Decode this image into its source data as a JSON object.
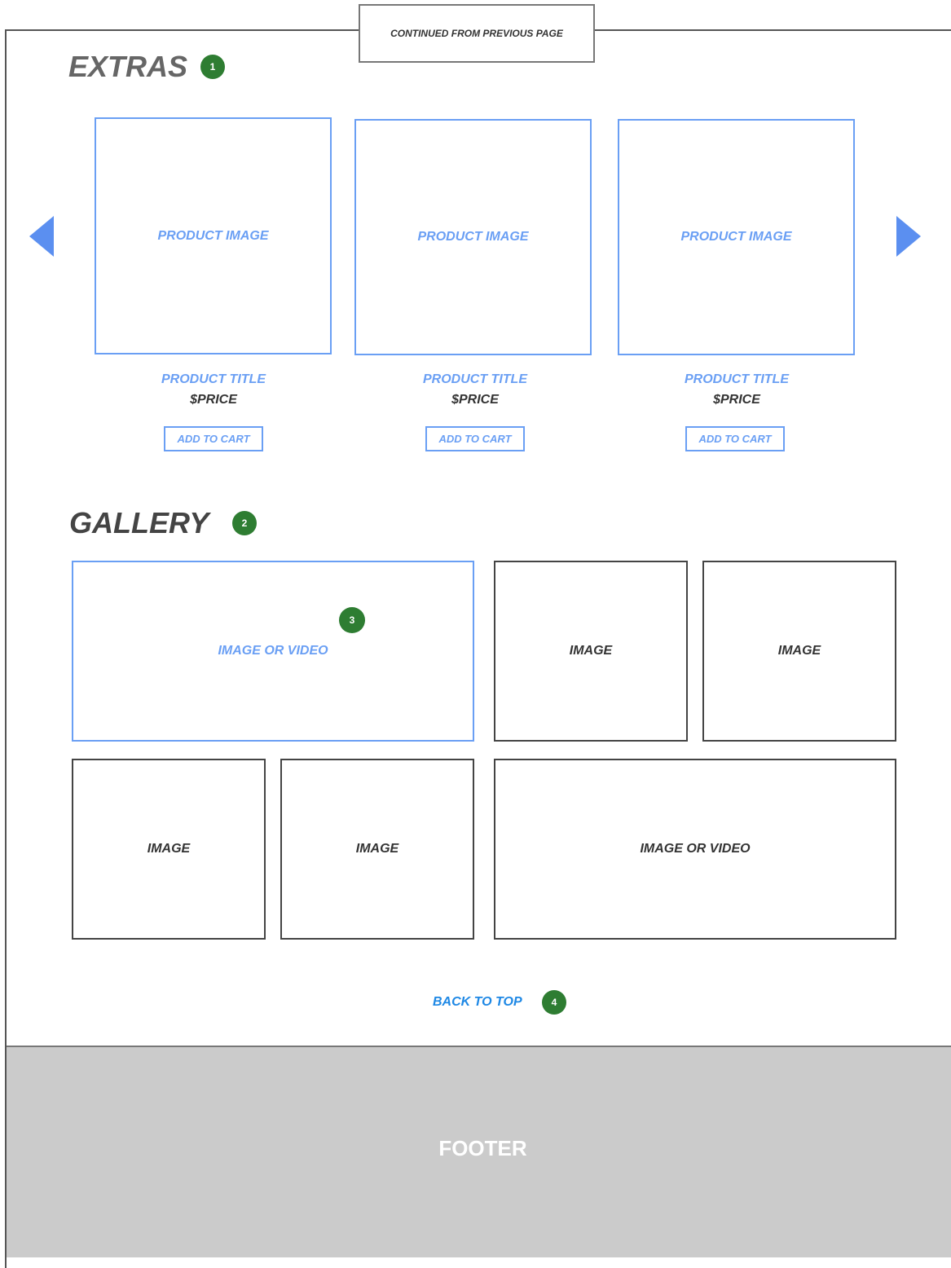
{
  "header": {
    "continued_label": "CONTINUED FROM PREVIOUS PAGE"
  },
  "extras": {
    "title": "EXTRAS",
    "badge": "1",
    "products": [
      {
        "image_label": "PRODUCT IMAGE",
        "title": "PRODUCT TITLE",
        "price": "$PRICE",
        "button": "ADD TO CART"
      },
      {
        "image_label": "PRODUCT IMAGE",
        "title": "PRODUCT TITLE",
        "price": "$PRICE",
        "button": "ADD TO CART"
      },
      {
        "image_label": "PRODUCT IMAGE",
        "title": "PRODUCT TITLE",
        "price": "$PRICE",
        "button": "ADD TO CART"
      }
    ],
    "prev_icon": "triangle-left-icon",
    "next_icon": "triangle-right-icon"
  },
  "gallery": {
    "title": "GALLERY",
    "badge": "2",
    "feature_badge": "3",
    "tiles": [
      "IMAGE OR VIDEO",
      "IMAGE",
      "IMAGE",
      "IMAGE",
      "IMAGE",
      "IMAGE OR VIDEO"
    ]
  },
  "back_to_top": {
    "label": "BACK TO TOP",
    "badge": "4"
  },
  "footer": {
    "label": "FOOTER"
  },
  "colors": {
    "accent_blue": "#6a9ff4",
    "link_blue": "#1e88e5",
    "badge_green": "#2e7d32",
    "footer_gray": "#cbcbcb"
  }
}
